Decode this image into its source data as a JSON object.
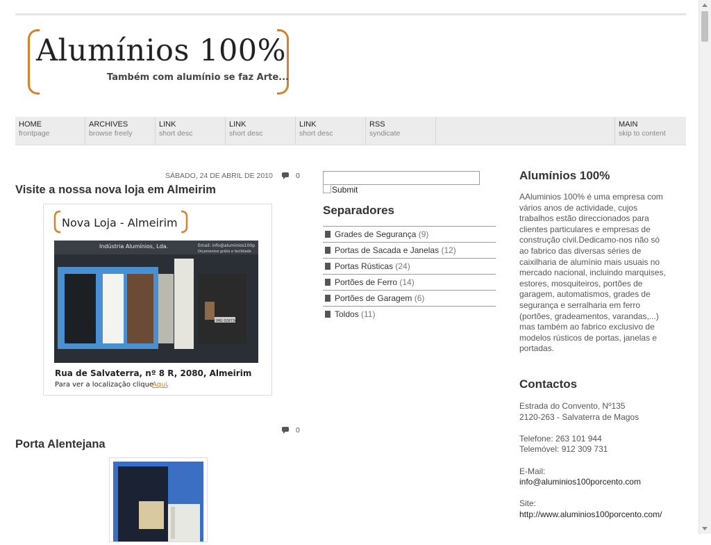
{
  "site": {
    "logo_title": "Alumínios 100%",
    "logo_tagline": "Também com alumínio se faz Arte...",
    "brand_color": "#d9802a"
  },
  "nav": [
    {
      "label": "HOME",
      "desc": "frontpage"
    },
    {
      "label": "ARCHIVES",
      "desc": "browse freely"
    },
    {
      "label": "LINK",
      "desc": "short desc"
    },
    {
      "label": "LINK",
      "desc": "short desc"
    },
    {
      "label": "LINK",
      "desc": "short desc"
    },
    {
      "label": "RSS",
      "desc": "syndicate"
    },
    {
      "label": "MAIN",
      "desc": "skip to content"
    }
  ],
  "posts": [
    {
      "date": "SÁBADO, 24 DE ABRIL DE 2010",
      "comments": "0",
      "title": "Visite a nossa nova loja em Almeirim",
      "image": {
        "heading": "Nova Loja - Almeirim",
        "sign_name": "Indústria Alumínios, Lda.",
        "sign_email": "Email: info@aluminios100p",
        "sign_note": "Orçamentos grátis e facilidade",
        "plate": "IMG 026734",
        "address": "Rua de Salvaterra, nº 8 R, 2080, Almeirim",
        "location_text": "Para ver a localização clique",
        "location_link": "Aqui",
        "location_end": "."
      }
    },
    {
      "comments": "0",
      "title": "Porta Alentejana"
    }
  ],
  "search": {
    "submit_label": "Submit"
  },
  "categories": {
    "heading": "Separadores",
    "items": [
      {
        "label": "Grades de Segurança",
        "count": "(9)"
      },
      {
        "label": "Portas de Sacada e Janelas",
        "count": "(12)"
      },
      {
        "label": "Portas Rústicas",
        "count": "(24)"
      },
      {
        "label": "Portões de Ferro",
        "count": "(14)"
      },
      {
        "label": "Portões de Garagem",
        "count": "(6)"
      },
      {
        "label": "Toldos",
        "count": "(11)"
      }
    ]
  },
  "about": {
    "heading": "Alumínios 100%",
    "text": "AAluminios 100% é uma empresa com vários anos de actividade, cujos trabalhos estão direccionados para clientes particulares e empresas de construção civil.Dedicamo-nos não só ao fabrico das diversas séries de caixilharia de alumínio mais usuais no mercado nacional, incluindo marquises, estores, mosquiteiros, portões de garagem, automatismos, grades de segurança e serralharia em ferro (portões, gradeamentos, varandas,...) mas também ao fabrico exclusivo de modelos rústicos de portas, janelas e portadas."
  },
  "contacts": {
    "heading": "Contactos",
    "address1": "Estrada do Convento, Nº135",
    "address2": "2120-263 - Salvaterra de Magos",
    "phone": "Telefone: 263 101 944",
    "mobile": "Telemóvel: 912 309 731",
    "email_label": "E-Mail:",
    "email": "info@aluminios100porcento.com",
    "site_label": "Site:",
    "site": "http://www.aluminios100porcento.com/"
  }
}
